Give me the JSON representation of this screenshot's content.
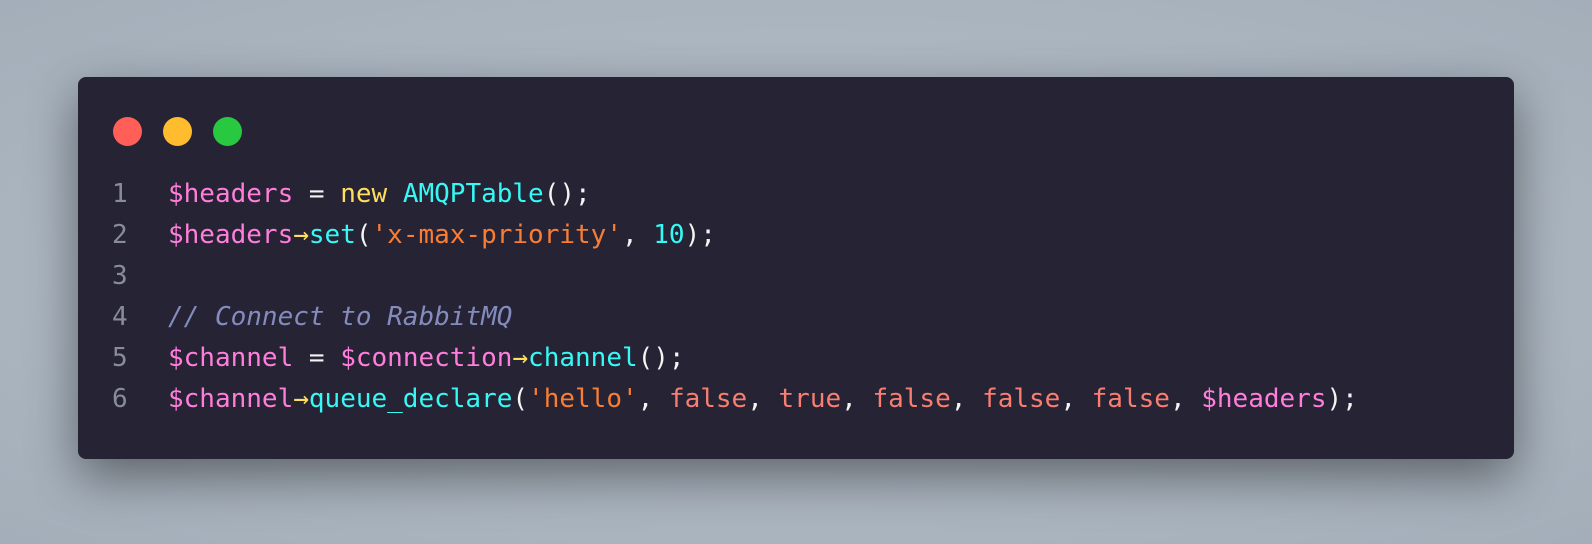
{
  "window": {
    "controls": [
      {
        "name": "close",
        "color": "#ff5f57"
      },
      {
        "name": "minimize",
        "color": "#febc2e"
      },
      {
        "name": "maximize",
        "color": "#28c840"
      }
    ]
  },
  "theme": {
    "background": "#262335",
    "colors": {
      "var": "#ff7edb",
      "plain": "#f4f4f4",
      "keyword": "#fede5d",
      "class": "#36f9f6",
      "func": "#36f9f6",
      "string": "#f97e34",
      "number": "#36f9f6",
      "comment": "#848bbd",
      "bool": "#f97e72",
      "arrow": "#fede5d"
    }
  },
  "code": {
    "lines": [
      {
        "num": "1",
        "tokens": [
          {
            "t": "$headers",
            "c": "var"
          },
          {
            "t": " = ",
            "c": "plain"
          },
          {
            "t": "new",
            "c": "keyword"
          },
          {
            "t": " ",
            "c": "plain"
          },
          {
            "t": "AMQPTable",
            "c": "class"
          },
          {
            "t": "();",
            "c": "plain"
          }
        ]
      },
      {
        "num": "2",
        "tokens": [
          {
            "t": "$headers",
            "c": "var"
          },
          {
            "t": "→",
            "c": "arrow"
          },
          {
            "t": "set",
            "c": "func"
          },
          {
            "t": "(",
            "c": "plain"
          },
          {
            "t": "'x-max-priority'",
            "c": "string"
          },
          {
            "t": ", ",
            "c": "plain"
          },
          {
            "t": "10",
            "c": "number"
          },
          {
            "t": ");",
            "c": "plain"
          }
        ]
      },
      {
        "num": "3",
        "tokens": []
      },
      {
        "num": "4",
        "tokens": [
          {
            "t": "// Connect to RabbitMQ",
            "c": "comment"
          }
        ]
      },
      {
        "num": "5",
        "tokens": [
          {
            "t": "$channel",
            "c": "var"
          },
          {
            "t": " = ",
            "c": "plain"
          },
          {
            "t": "$connection",
            "c": "var"
          },
          {
            "t": "→",
            "c": "arrow"
          },
          {
            "t": "channel",
            "c": "func"
          },
          {
            "t": "();",
            "c": "plain"
          }
        ]
      },
      {
        "num": "6",
        "tokens": [
          {
            "t": "$channel",
            "c": "var"
          },
          {
            "t": "→",
            "c": "arrow"
          },
          {
            "t": "queue_declare",
            "c": "func"
          },
          {
            "t": "(",
            "c": "plain"
          },
          {
            "t": "'hello'",
            "c": "string"
          },
          {
            "t": ", ",
            "c": "plain"
          },
          {
            "t": "false",
            "c": "bool"
          },
          {
            "t": ", ",
            "c": "plain"
          },
          {
            "t": "true",
            "c": "bool"
          },
          {
            "t": ", ",
            "c": "plain"
          },
          {
            "t": "false",
            "c": "bool"
          },
          {
            "t": ", ",
            "c": "plain"
          },
          {
            "t": "false",
            "c": "bool"
          },
          {
            "t": ", ",
            "c": "plain"
          },
          {
            "t": "false",
            "c": "bool"
          },
          {
            "t": ", ",
            "c": "plain"
          },
          {
            "t": "$headers",
            "c": "var"
          },
          {
            "t": ");",
            "c": "plain"
          }
        ]
      }
    ]
  }
}
